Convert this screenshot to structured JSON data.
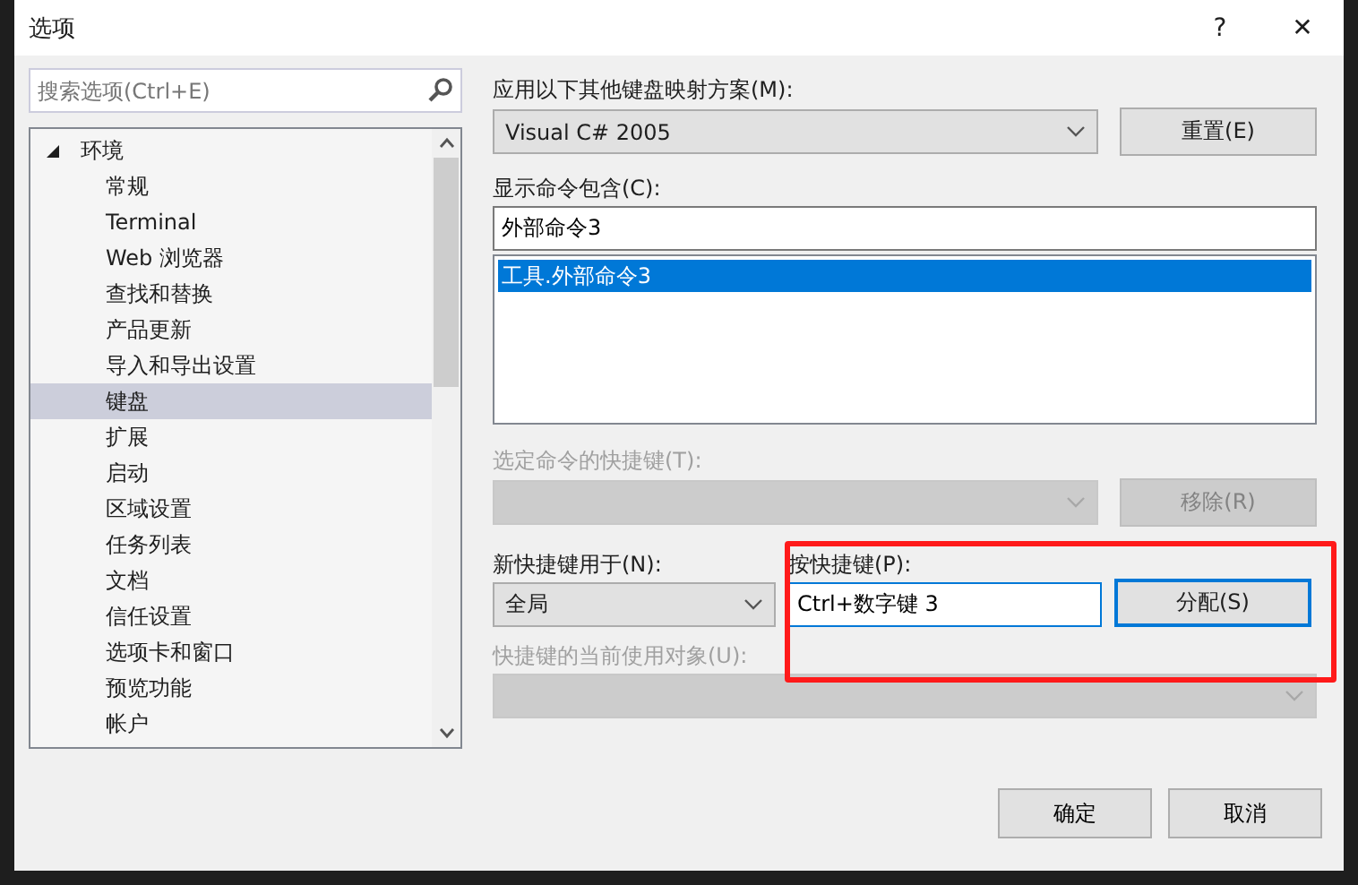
{
  "window": {
    "title": "选项",
    "help": "?",
    "close": "✕"
  },
  "search": {
    "placeholder": "搜索选项(Ctrl+E)"
  },
  "tree": [
    {
      "label": "环境",
      "expanded": true,
      "selected": false,
      "children": [
        {
          "label": "常规",
          "selected": false
        },
        {
          "label": "Terminal",
          "selected": false
        },
        {
          "label": "Web 浏览器",
          "selected": false
        },
        {
          "label": "查找和替换",
          "selected": false
        },
        {
          "label": "产品更新",
          "selected": false
        },
        {
          "label": "导入和导出设置",
          "selected": false
        },
        {
          "label": "键盘",
          "selected": true
        },
        {
          "label": "扩展",
          "selected": false
        },
        {
          "label": "启动",
          "selected": false
        },
        {
          "label": "区域设置",
          "selected": false
        },
        {
          "label": "任务列表",
          "selected": false
        },
        {
          "label": "文档",
          "selected": false
        },
        {
          "label": "信任设置",
          "selected": false
        },
        {
          "label": "选项卡和窗口",
          "selected": false
        },
        {
          "label": "预览功能",
          "selected": false
        },
        {
          "label": "帐户",
          "selected": false
        }
      ]
    }
  ],
  "mapping": {
    "label": "应用以下其他键盘映射方案(M):",
    "value": "Visual C# 2005",
    "button": "重置(E)"
  },
  "commands": {
    "label": "显示命令包含(C):",
    "value": "外部命令3",
    "items": [
      {
        "label": "工具.外部命令3",
        "selected": true
      }
    ]
  },
  "current_shortcuts": {
    "label": "选定命令的快捷键(T):",
    "disabled": true,
    "button": "移除(R)"
  },
  "use_in": {
    "label": "新快捷键用于(N):",
    "value": "全局"
  },
  "press_keys": {
    "label": "按快捷键(P):",
    "value": "Ctrl+数字键 3",
    "button": "分配(S)",
    "button_focused": true,
    "highlighted": true
  },
  "used_by": {
    "label": "快捷键的当前使用对象(U):",
    "disabled": true
  },
  "buttons": [
    "确定",
    "取消"
  ]
}
